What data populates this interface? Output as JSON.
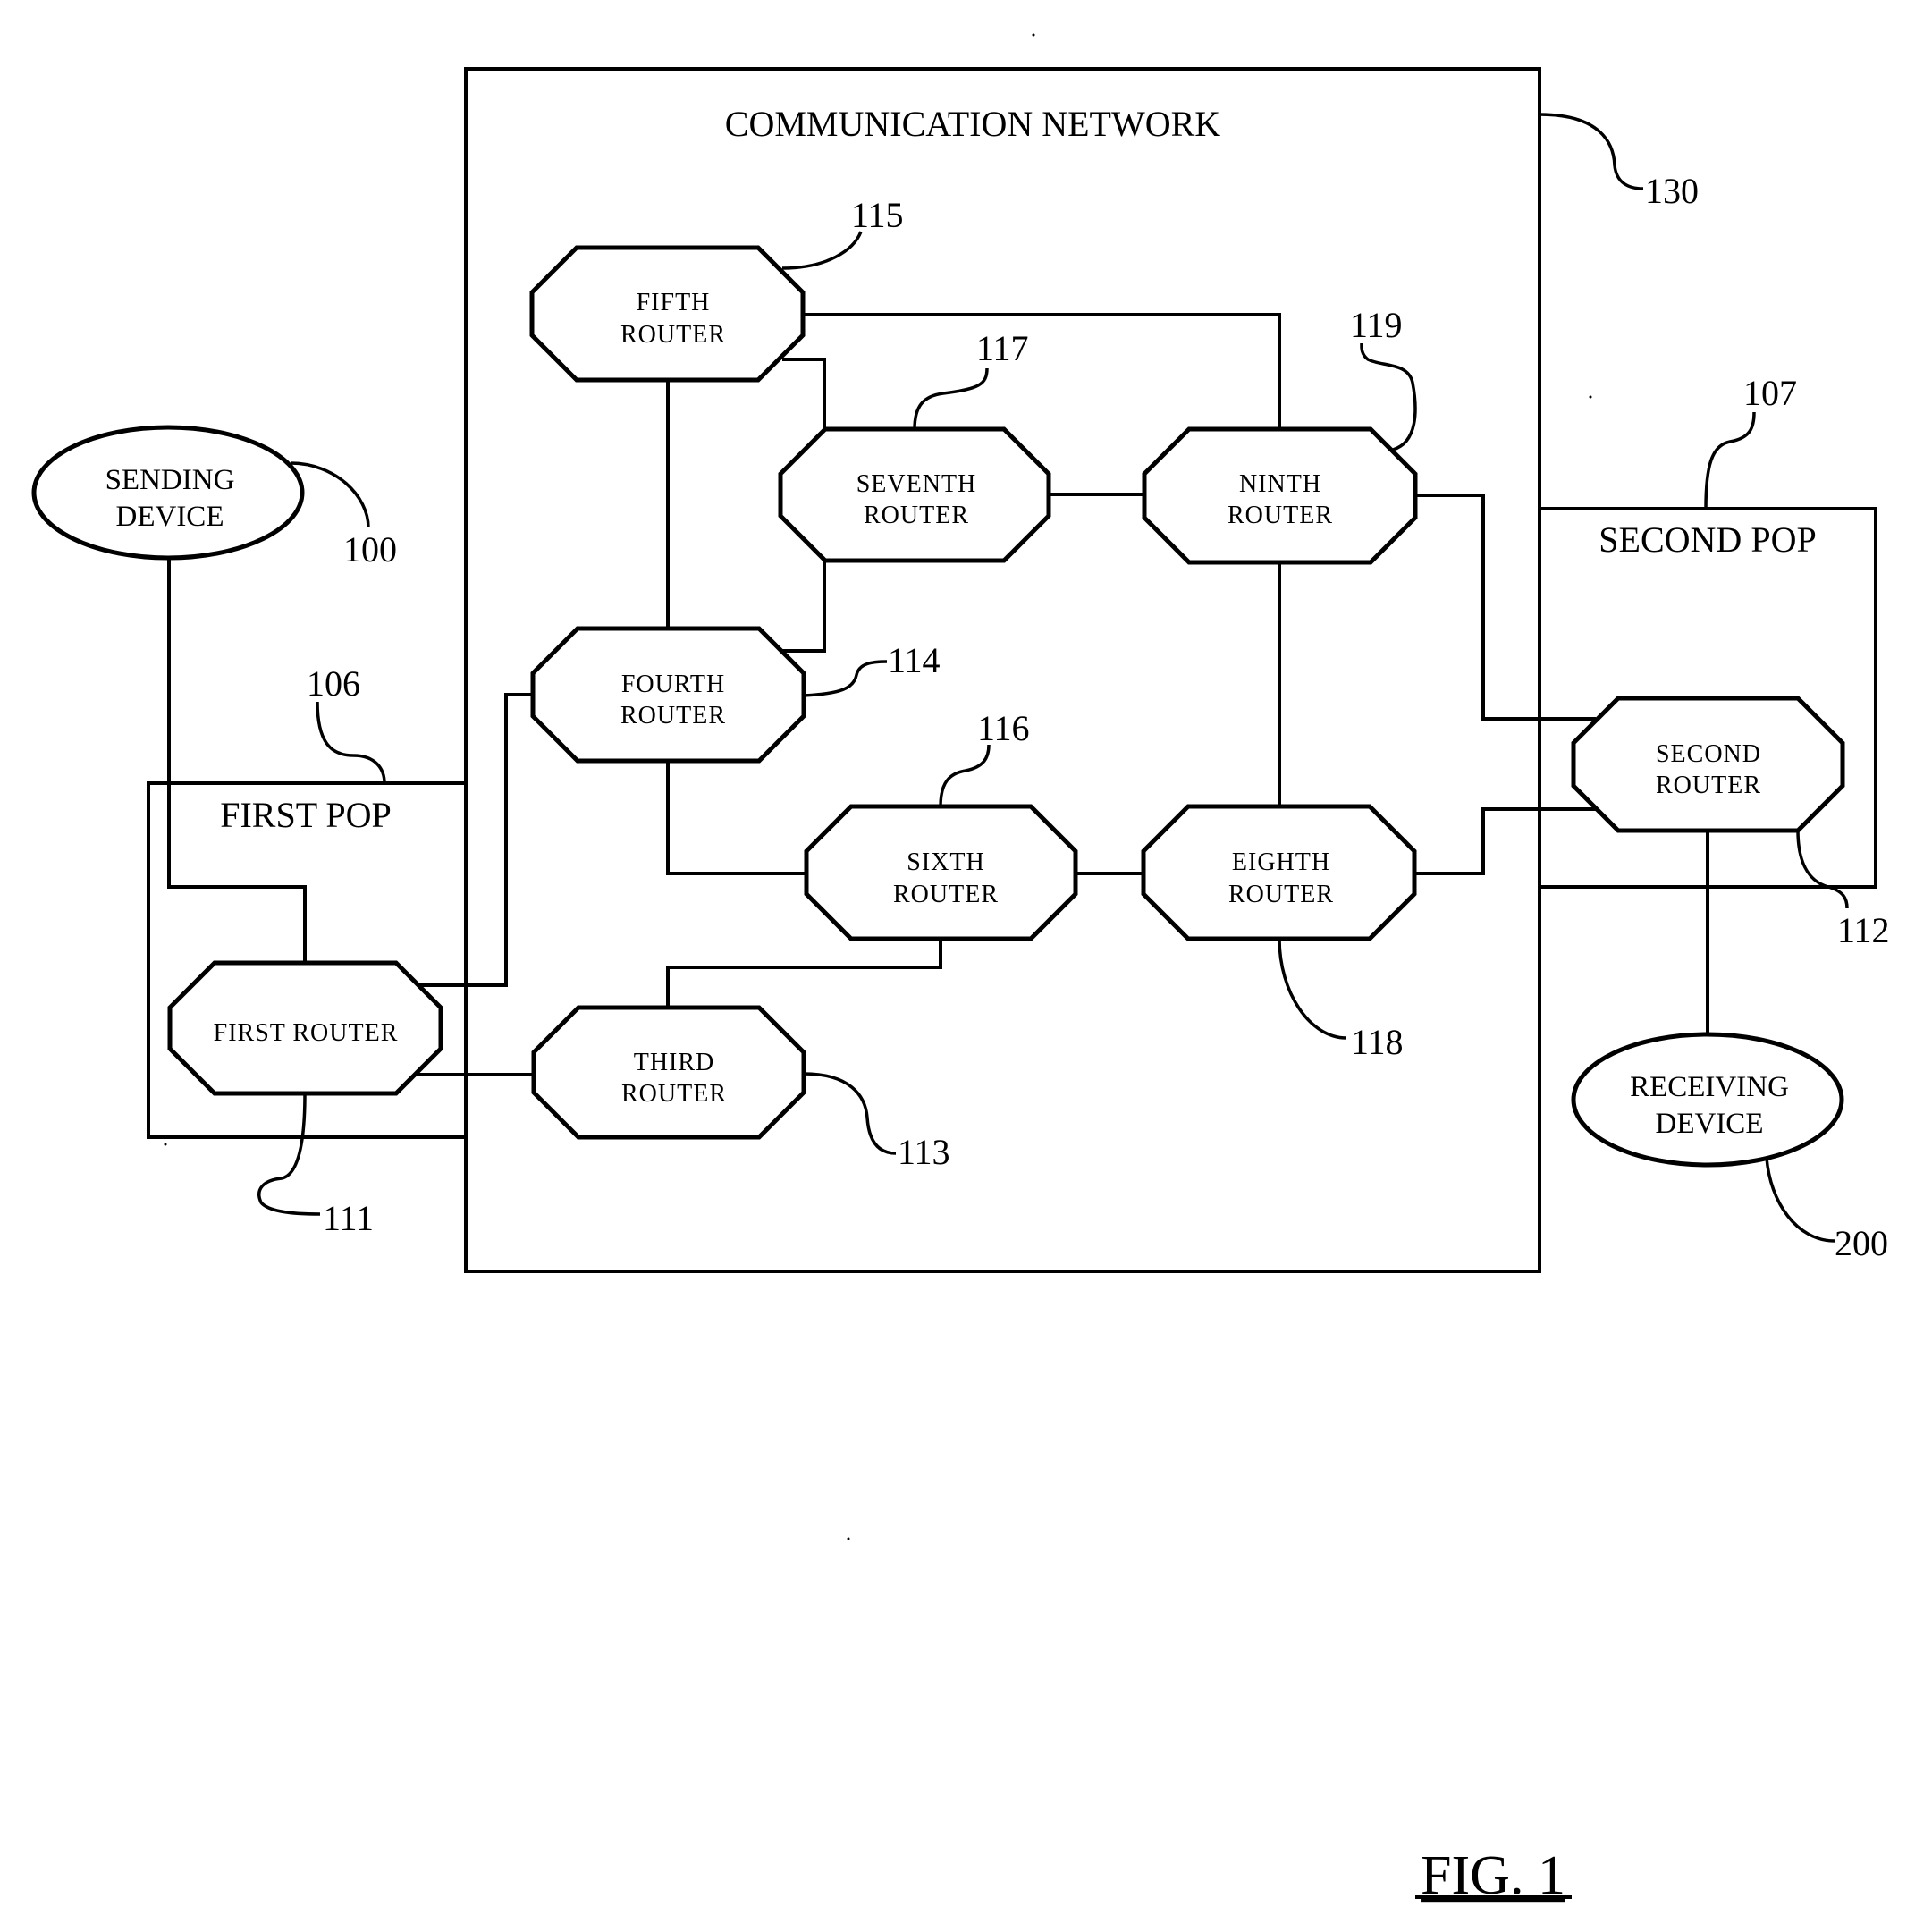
{
  "figure": {
    "label": "FIG. 1"
  },
  "network": {
    "title": "COMMUNICATION NETWORK",
    "ref": "130"
  },
  "pops": {
    "first": {
      "label": "FIRST POP",
      "ref": "106"
    },
    "second": {
      "label": "SECOND POP",
      "ref": "107"
    }
  },
  "devices": {
    "sending": {
      "line1": "SENDING",
      "line2": "DEVICE",
      "ref": "100"
    },
    "receiving": {
      "line1": "RECEIVING",
      "line2": "DEVICE",
      "ref": "200"
    }
  },
  "routers": {
    "first": {
      "label": "FIRST ROUTER",
      "ref": "111"
    },
    "second": {
      "line1": "SECOND",
      "line2": "ROUTER",
      "ref": "112"
    },
    "third": {
      "line1": "THIRD",
      "line2": "ROUTER",
      "ref": "113"
    },
    "fourth": {
      "line1": "FOURTH",
      "line2": "ROUTER",
      "ref": "114"
    },
    "fifth": {
      "line1": "FIFTH",
      "line2": "ROUTER",
      "ref": "115"
    },
    "sixth": {
      "line1": "SIXTH",
      "line2": "ROUTER",
      "ref": "116"
    },
    "seventh": {
      "line1": "SEVENTH",
      "line2": "ROUTER",
      "ref": "117"
    },
    "eighth": {
      "line1": "EIGHTH",
      "line2": "ROUTER",
      "ref": "118"
    },
    "ninth": {
      "line1": "NINTH",
      "line2": "ROUTER",
      "ref": "119"
    }
  },
  "connections": [
    [
      "sending-device",
      "first-router"
    ],
    [
      "first-router",
      "fourth-router"
    ],
    [
      "first-router",
      "third-router"
    ],
    [
      "fourth-router",
      "fifth-router"
    ],
    [
      "fourth-router",
      "seventh-router"
    ],
    [
      "fourth-router",
      "sixth-router"
    ],
    [
      "fifth-router",
      "seventh-router"
    ],
    [
      "fifth-router",
      "ninth-router"
    ],
    [
      "seventh-router",
      "ninth-router"
    ],
    [
      "sixth-router",
      "eighth-router"
    ],
    [
      "sixth-router",
      "third-router"
    ],
    [
      "ninth-router",
      "eighth-router"
    ],
    [
      "ninth-router",
      "second-router"
    ],
    [
      "eighth-router",
      "second-router"
    ],
    [
      "second-router",
      "receiving-device"
    ]
  ]
}
